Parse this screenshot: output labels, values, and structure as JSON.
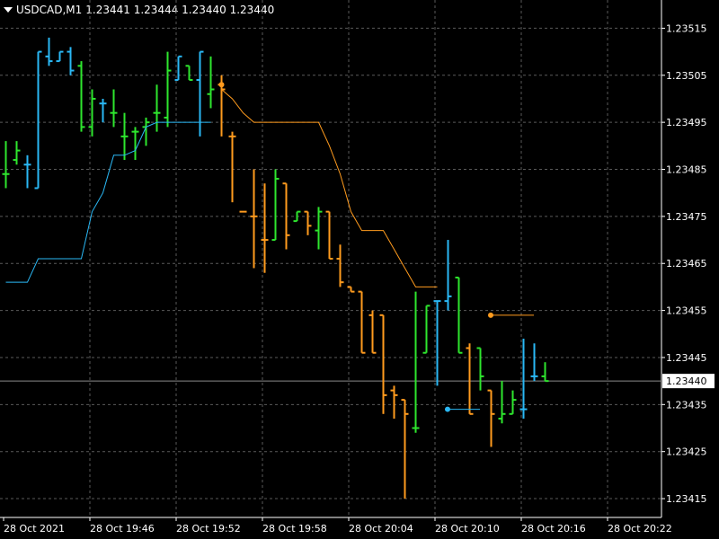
{
  "header": {
    "symbol": "USDCAD,M1",
    "ohlc": "1.23441 1.23444 1.23440 1.23440"
  },
  "colors": {
    "background": "#000000",
    "grid": "#5a5a5a",
    "bull": "#2EE62E",
    "bear": "#FF9B1E",
    "stop_bull": "#2AB8F5",
    "stop_bear": "#FF9B1E",
    "bid_line": "#8a8a8a"
  },
  "chart_data": {
    "type": "ohlc",
    "ylim": [
      1.23411,
      1.23521
    ],
    "y_ticks": [
      "1.23515",
      "1.23505",
      "1.23495",
      "1.23485",
      "1.23475",
      "1.23465",
      "1.23455",
      "1.23445",
      "1.23435",
      "1.23425",
      "1.23415"
    ],
    "x_ticks": [
      "28 Oct 2021",
      "28 Oct 19:46",
      "28 Oct 19:52",
      "28 Oct 19:58",
      "28 Oct 20:04",
      "28 Oct 20:10",
      "28 Oct 20:16",
      "28 Oct 20:22"
    ],
    "current_price": "1.23440",
    "bars": [
      {
        "o": 1.23484,
        "h": 1.23491,
        "l": 1.23481,
        "c": 1.23484,
        "color": "bull"
      },
      {
        "o": 1.23487,
        "h": 1.23491,
        "l": 1.23486,
        "c": 1.23489,
        "color": "bull"
      },
      {
        "o": 1.23486,
        "h": 1.23488,
        "l": 1.23481,
        "c": 1.23486,
        "color": "stop_bull"
      },
      {
        "o": 1.23481,
        "h": 1.2351,
        "l": 1.23481,
        "c": 1.2351,
        "color": "stop_bull"
      },
      {
        "o": 1.23509,
        "h": 1.23513,
        "l": 1.23507,
        "c": 1.23508,
        "color": "stop_bull"
      },
      {
        "o": 1.23508,
        "h": 1.2351,
        "l": 1.23508,
        "c": 1.2351,
        "color": "stop_bull"
      },
      {
        "o": 1.2351,
        "h": 1.23511,
        "l": 1.23505,
        "c": 1.23506,
        "color": "stop_bull"
      },
      {
        "o": 1.23507,
        "h": 1.23508,
        "l": 1.23493,
        "c": 1.23494,
        "color": "bull"
      },
      {
        "o": 1.23494,
        "h": 1.23502,
        "l": 1.23492,
        "c": 1.235,
        "color": "bull"
      },
      {
        "o": 1.23499,
        "h": 1.235,
        "l": 1.23495,
        "c": 1.23499,
        "color": "stop_bull"
      },
      {
        "o": 1.23497,
        "h": 1.23502,
        "l": 1.23494,
        "c": 1.23497,
        "color": "bull"
      },
      {
        "o": 1.23492,
        "h": 1.23497,
        "l": 1.23487,
        "c": 1.23492,
        "color": "bull"
      },
      {
        "o": 1.23493,
        "h": 1.23494,
        "l": 1.23487,
        "c": 1.23493,
        "color": "bull"
      },
      {
        "o": 1.23494,
        "h": 1.23496,
        "l": 1.2349,
        "c": 1.23495,
        "color": "bull"
      },
      {
        "o": 1.23497,
        "h": 1.23503,
        "l": 1.23493,
        "c": 1.23497,
        "color": "bull"
      },
      {
        "o": 1.23496,
        "h": 1.2351,
        "l": 1.23494,
        "c": 1.23506,
        "color": "bull"
      },
      {
        "o": 1.23504,
        "h": 1.23509,
        "l": 1.23504,
        "c": 1.23509,
        "color": "stop_bull"
      },
      {
        "o": 1.23507,
        "h": 1.23507,
        "l": 1.23504,
        "c": 1.23504,
        "color": "bull"
      },
      {
        "o": 1.23504,
        "h": 1.2351,
        "l": 1.23492,
        "c": 1.2351,
        "color": "stop_bull"
      },
      {
        "o": 1.23501,
        "h": 1.23509,
        "l": 1.23498,
        "c": 1.23502,
        "color": "bull"
      },
      {
        "o": 1.23503,
        "h": 1.23505,
        "l": 1.23492,
        "c": 1.23502,
        "color": "bear"
      },
      {
        "o": 1.23492,
        "h": 1.23493,
        "l": 1.23478,
        "c": 1.23492,
        "color": "bear"
      },
      {
        "o": 1.23476,
        "h": 1.23476,
        "l": 1.23476,
        "c": 1.23476,
        "color": "bear"
      },
      {
        "o": 1.23475,
        "h": 1.23485,
        "l": 1.23464,
        "c": 1.23475,
        "color": "bear"
      },
      {
        "o": 1.2347,
        "h": 1.23482,
        "l": 1.23463,
        "c": 1.2347,
        "color": "bear"
      },
      {
        "o": 1.2347,
        "h": 1.23485,
        "l": 1.2347,
        "c": 1.23483,
        "color": "bull"
      },
      {
        "o": 1.23482,
        "h": 1.23482,
        "l": 1.23468,
        "c": 1.23471,
        "color": "bear"
      },
      {
        "o": 1.23474,
        "h": 1.23476,
        "l": 1.23474,
        "c": 1.23476,
        "color": "bull"
      },
      {
        "o": 1.23476,
        "h": 1.23476,
        "l": 1.23471,
        "c": 1.23473,
        "color": "bear"
      },
      {
        "o": 1.23472,
        "h": 1.23477,
        "l": 1.23468,
        "c": 1.23476,
        "color": "bull"
      },
      {
        "o": 1.23476,
        "h": 1.23476,
        "l": 1.23466,
        "c": 1.23466,
        "color": "bear"
      },
      {
        "o": 1.23466,
        "h": 1.23469,
        "l": 1.2346,
        "c": 1.23461,
        "color": "bear"
      },
      {
        "o": 1.2346,
        "h": 1.2346,
        "l": 1.23459,
        "c": 1.23459,
        "color": "bear"
      },
      {
        "o": 1.23459,
        "h": 1.23459,
        "l": 1.23446,
        "c": 1.23446,
        "color": "bear"
      },
      {
        "o": 1.23454,
        "h": 1.23455,
        "l": 1.23446,
        "c": 1.23446,
        "color": "bear"
      },
      {
        "o": 1.23454,
        "h": 1.23454,
        "l": 1.23433,
        "c": 1.23437,
        "color": "bear"
      },
      {
        "o": 1.23438,
        "h": 1.23439,
        "l": 1.23432,
        "c": 1.23437,
        "color": "bear"
      },
      {
        "o": 1.23436,
        "h": 1.23436,
        "l": 1.23415,
        "c": 1.23433,
        "color": "bear"
      },
      {
        "o": 1.2343,
        "h": 1.23459,
        "l": 1.23429,
        "c": 1.2343,
        "color": "bull"
      },
      {
        "o": 1.23446,
        "h": 1.23456,
        "l": 1.23446,
        "c": 1.23456,
        "color": "bull"
      },
      {
        "o": 1.23457,
        "h": 1.23457,
        "l": 1.23439,
        "c": 1.23457,
        "color": "stop_bull"
      },
      {
        "o": 1.23457,
        "h": 1.2347,
        "l": 1.23455,
        "c": 1.23458,
        "color": "stop_bull"
      },
      {
        "o": 1.23462,
        "h": 1.23462,
        "l": 1.23446,
        "c": 1.23446,
        "color": "bull"
      },
      {
        "o": 1.23447,
        "h": 1.23448,
        "l": 1.23433,
        "c": 1.23433,
        "color": "bear"
      },
      {
        "o": 1.23447,
        "h": 1.23447,
        "l": 1.23438,
        "c": 1.23441,
        "color": "bull"
      },
      {
        "o": 1.23438,
        "h": 1.23438,
        "l": 1.23426,
        "c": 1.23433,
        "color": "bear"
      },
      {
        "o": 1.23432,
        "h": 1.2344,
        "l": 1.23431,
        "c": 1.23433,
        "color": "bull"
      },
      {
        "o": 1.23433,
        "h": 1.23438,
        "l": 1.23433,
        "c": 1.23436,
        "color": "bull"
      },
      {
        "o": 1.23434,
        "h": 1.23449,
        "l": 1.23432,
        "c": 1.23434,
        "color": "stop_bull"
      },
      {
        "o": 1.23441,
        "h": 1.23448,
        "l": 1.2344,
        "c": 1.23441,
        "color": "stop_bull"
      },
      {
        "o": 1.23441,
        "h": 1.23444,
        "l": 1.2344,
        "c": 1.2344,
        "color": "bull"
      }
    ],
    "support_line": [
      [
        0,
        1.23461
      ],
      [
        1,
        1.23461
      ],
      [
        2,
        1.23461
      ],
      [
        3,
        1.23466
      ],
      [
        4,
        1.23466
      ],
      [
        5,
        1.23466
      ],
      [
        6,
        1.23466
      ],
      [
        7,
        1.23466
      ],
      [
        8,
        1.23476
      ],
      [
        9,
        1.2348
      ],
      [
        10,
        1.23488
      ],
      [
        11,
        1.23488
      ],
      [
        12,
        1.23489
      ],
      [
        13,
        1.23494
      ],
      [
        14,
        1.23495
      ],
      [
        15,
        1.23495
      ],
      [
        16,
        1.23495
      ],
      [
        17,
        1.23495
      ],
      [
        18,
        1.23495
      ],
      [
        19,
        1.23495
      ]
    ],
    "resistance_line": [
      [
        20,
        1.23502
      ],
      [
        21,
        1.235
      ],
      [
        22,
        1.23497
      ],
      [
        23,
        1.23495
      ],
      [
        24,
        1.23495
      ],
      [
        25,
        1.23495
      ],
      [
        26,
        1.23495
      ],
      [
        27,
        1.23495
      ],
      [
        28,
        1.23495
      ],
      [
        29,
        1.23495
      ],
      [
        30,
        1.2349
      ],
      [
        31,
        1.23484
      ],
      [
        32,
        1.23476
      ],
      [
        33,
        1.23472
      ],
      [
        34,
        1.23472
      ],
      [
        35,
        1.23472
      ],
      [
        36,
        1.23468
      ],
      [
        37,
        1.23464
      ],
      [
        38,
        1.2346
      ],
      [
        39,
        1.2346
      ],
      [
        40,
        1.2346
      ]
    ],
    "signal_up": {
      "bar": 41,
      "price": 1.23434,
      "end_bar": 44
    },
    "signal_down": {
      "bar": 45,
      "price": 1.23454,
      "end_bar": 49
    },
    "signal_down_start": {
      "bar": 20,
      "price": 1.23503
    }
  }
}
